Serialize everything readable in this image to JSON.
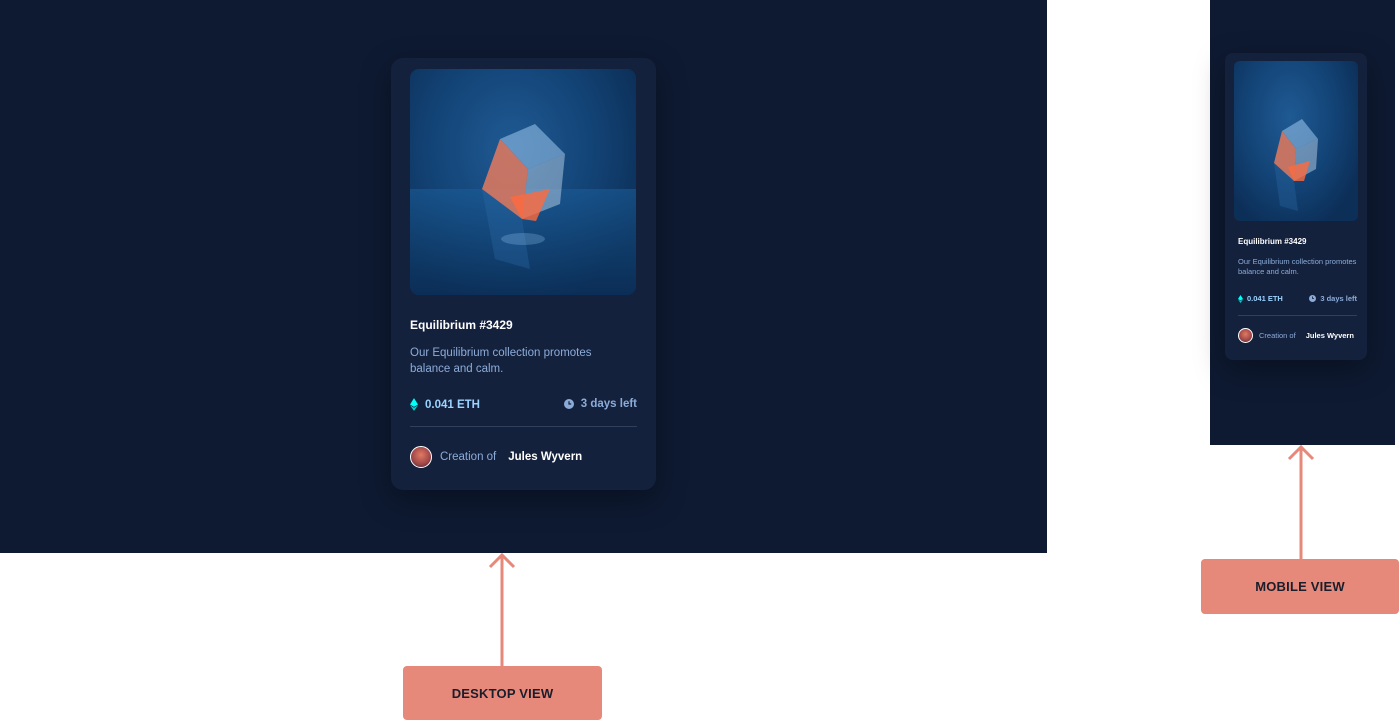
{
  "card": {
    "title": "Equilibrium #3429",
    "description": "Our Equilibrium collection promotes balance and calm.",
    "price": "0.041 ETH",
    "time_left": "3 days left",
    "creator_prefix": "Creation of",
    "creator_name": "Jules Wyvern"
  },
  "labels": {
    "desktop": "DESKTOP VIEW",
    "mobile": "MOBILE VIEW"
  },
  "colors": {
    "page_bg": "#0e1a32",
    "card_bg": "#14213d",
    "accent_cyan": "#00fff8",
    "soft_blue": "#8bacd9",
    "label_bg": "#e6897a"
  },
  "icons": [
    "ethereum-icon",
    "clock-icon",
    "avatar-image",
    "arrow-up-icon"
  ]
}
